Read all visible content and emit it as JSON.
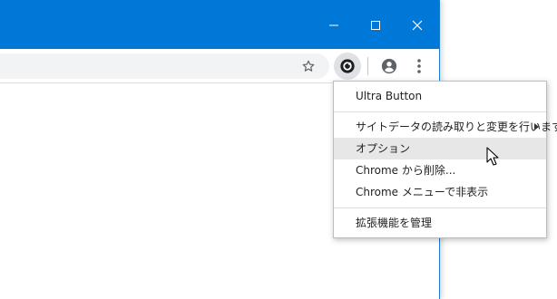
{
  "titlebar": {
    "color": "#0078d7"
  },
  "toolbar": {
    "icons": [
      "star-icon",
      "ultra-button-extension-icon",
      "profile-icon",
      "kebab-menu-icon"
    ]
  },
  "menu": {
    "title": "Ultra Button",
    "items": [
      {
        "label": "サイトデータの読み取りと変更を行います",
        "has_submenu": true
      },
      {
        "label": "オプション",
        "highlighted": true
      },
      {
        "label": "Chrome から削除..."
      },
      {
        "label": "Chrome メニューで非表示"
      }
    ],
    "manage": "拡張機能を管理"
  }
}
